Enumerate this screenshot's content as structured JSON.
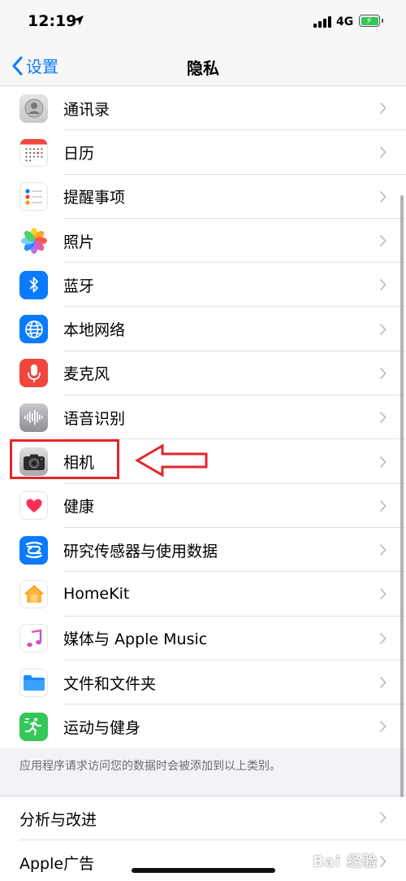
{
  "status": {
    "time": "12:19",
    "network": "4G"
  },
  "nav": {
    "back_label": "设置",
    "title": "隐私"
  },
  "items": [
    {
      "id": "contacts",
      "label": "通讯录",
      "icon": "contacts-icon"
    },
    {
      "id": "calendar",
      "label": "日历",
      "icon": "calendar-icon"
    },
    {
      "id": "reminders",
      "label": "提醒事项",
      "icon": "reminders-icon"
    },
    {
      "id": "photos",
      "label": "照片",
      "icon": "photos-icon"
    },
    {
      "id": "bluetooth",
      "label": "蓝牙",
      "icon": "bluetooth-icon"
    },
    {
      "id": "local-network",
      "label": "本地网络",
      "icon": "globe-icon"
    },
    {
      "id": "microphone",
      "label": "麦克风",
      "icon": "microphone-icon"
    },
    {
      "id": "speech",
      "label": "语音识别",
      "icon": "waveform-icon"
    },
    {
      "id": "camera",
      "label": "相机",
      "icon": "camera-icon"
    },
    {
      "id": "health",
      "label": "健康",
      "icon": "heart-icon"
    },
    {
      "id": "research",
      "label": "研究传感器与使用数据",
      "icon": "research-icon"
    },
    {
      "id": "homekit",
      "label": "HomeKit",
      "icon": "home-icon"
    },
    {
      "id": "media",
      "label": "媒体与 Apple Music",
      "icon": "music-note-icon"
    },
    {
      "id": "files",
      "label": "文件和文件夹",
      "icon": "folder-icon"
    },
    {
      "id": "fitness",
      "label": "运动与健身",
      "icon": "running-figure-icon"
    }
  ],
  "footer_note": "应用程序请求访问您的数据时会被添加到以上类别。",
  "group2": [
    {
      "label": "分析与改进"
    },
    {
      "label": "Apple广告"
    }
  ],
  "watermark": "Bai 经验",
  "colors": {
    "accent": "#0a7aff",
    "highlight": "#e3262b"
  }
}
